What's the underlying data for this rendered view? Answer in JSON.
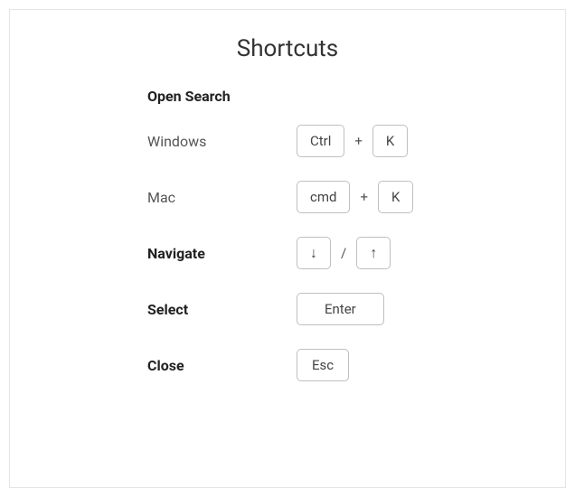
{
  "title": "Shortcuts",
  "sections": {
    "openSearch": {
      "label": "Open Search",
      "windows": {
        "label": "Windows",
        "keys": [
          "Ctrl",
          "K"
        ],
        "separator": "+"
      },
      "mac": {
        "label": "Mac",
        "keys": [
          "cmd",
          "K"
        ],
        "separator": "+"
      }
    },
    "navigate": {
      "label": "Navigate",
      "keys": [
        "↓",
        "↑"
      ],
      "separator": "/"
    },
    "select": {
      "label": "Select",
      "keys": [
        "Enter"
      ]
    },
    "close": {
      "label": "Close",
      "keys": [
        "Esc"
      ]
    }
  }
}
